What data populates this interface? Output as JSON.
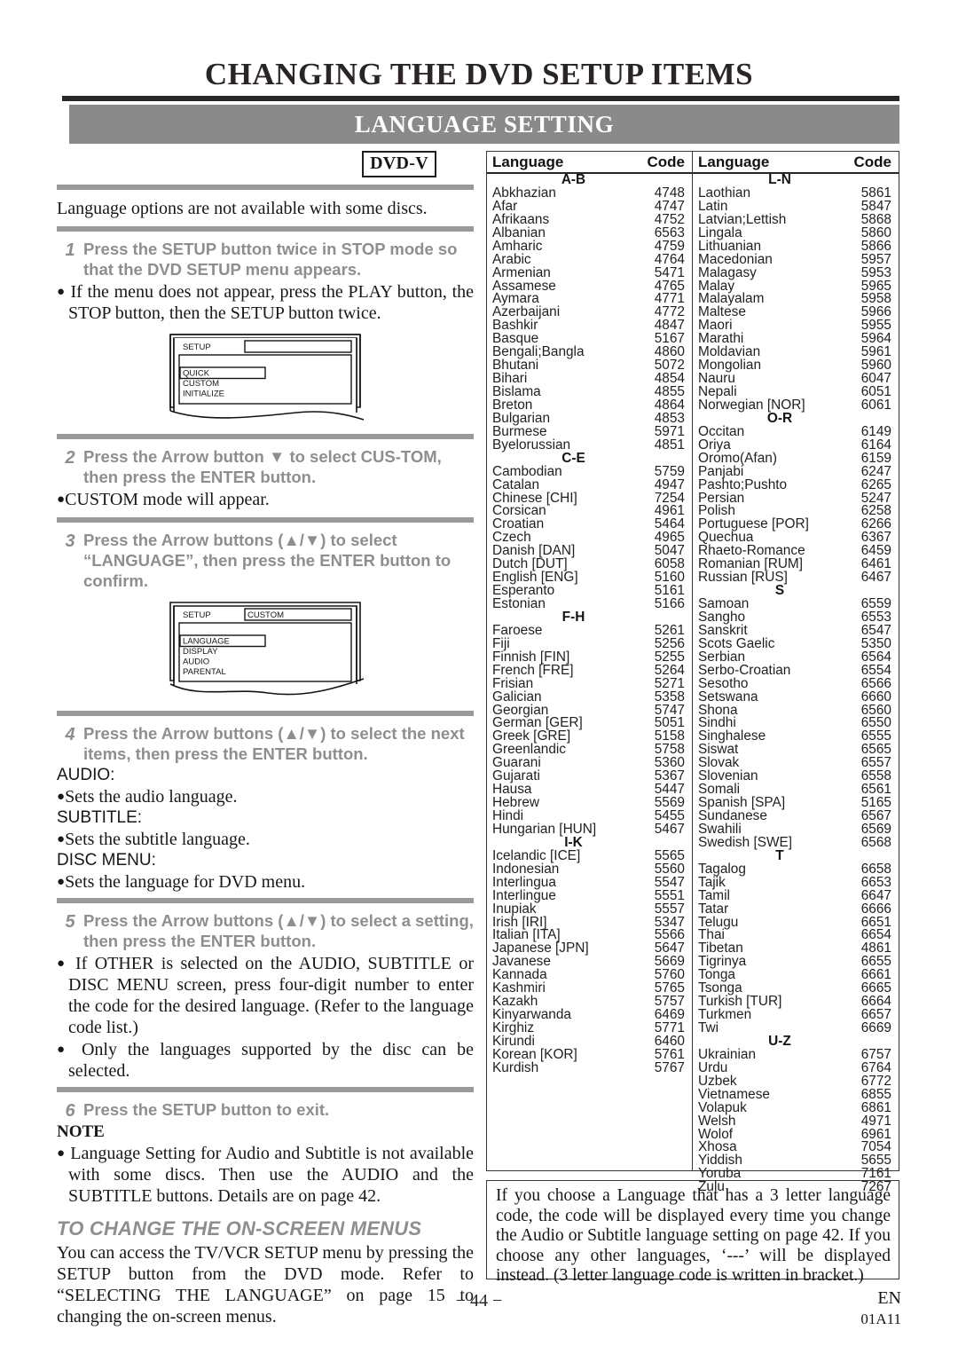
{
  "header": {
    "title": "CHANGING THE DVD SETUP ITEMS",
    "band_title": "LANGUAGE SETTING"
  },
  "left": {
    "badge": "DVD-V",
    "intro": "Language options are not available with some discs.",
    "step1": {
      "num": "1",
      "text": "Press the SETUP button twice in STOP mode so that the DVD SETUP menu appears."
    },
    "step1_bullet": "If the menu does not appear, press the PLAY button, the STOP button, then the SETUP button twice.",
    "osd1": {
      "label": "SETUP",
      "value": "",
      "items": [
        "QUICK",
        "CUSTOM",
        "INITIALIZE"
      ],
      "highlighted": "QUICK"
    },
    "step2": {
      "num": "2",
      "text": "Press the Arrow button ▼ to select CUS-TOM, then press the ENTER button."
    },
    "step2_bullet": "CUSTOM mode will appear.",
    "step3": {
      "num": "3",
      "text": "Press the Arrow buttons (▲/▼) to select “LANGUAGE”, then press the ENTER button to confirm."
    },
    "osd2": {
      "label": "SETUP",
      "value": "CUSTOM",
      "items": [
        "LANGUAGE",
        "DISPLAY",
        "AUDIO",
        "PARENTAL"
      ],
      "highlighted": "LANGUAGE"
    },
    "step4": {
      "num": "4",
      "text": "Press the Arrow buttons (▲/▼) to select the next items, then press the ENTER button."
    },
    "items": [
      {
        "head": "AUDIO:",
        "desc": "Sets the audio language."
      },
      {
        "head": "SUBTITLE:",
        "desc": "Sets the subtitle language."
      },
      {
        "head": "DISC MENU:",
        "desc": "Sets the language for DVD menu."
      }
    ],
    "step5": {
      "num": "5",
      "text": "Press the Arrow buttons (▲/▼) to select a setting, then press the ENTER button."
    },
    "step5_bullet1": "If OTHER is selected on the AUDIO, SUBTITLE or DISC MENU screen, press four-digit number to enter the code for the desired language. (Refer to the language code list.)",
    "step5_bullet2": "Only the languages supported by the disc can be selected.",
    "step6": {
      "num": "6",
      "text": "Press the SETUP button to exit."
    },
    "note_head": "NOTE",
    "note_bullet": "Language Setting for Audio and Subtitle is not available with some discs. Then use the AUDIO and the SUBTITLE buttons. Details are on page 42.",
    "onscreen_head": "TO CHANGE THE ON-SCREEN MENUS",
    "onscreen_body": "You can access the TV/VCR SETUP menu by pressing the SETUP button from the DVD mode. Refer to “SELECTING THE LANGUAGE” on page 15 to changing the on-screen menus."
  },
  "table": {
    "columns": [
      "Language",
      "Code"
    ],
    "left_column": [
      {
        "section": "A-B"
      },
      {
        "name": "Abkhazian",
        "code": "4748"
      },
      {
        "name": "Afar",
        "code": "4747"
      },
      {
        "name": "Afrikaans",
        "code": "4752"
      },
      {
        "name": "Albanian",
        "code": "6563"
      },
      {
        "name": "Amharic",
        "code": "4759"
      },
      {
        "name": "Arabic",
        "code": "4764"
      },
      {
        "name": "Armenian",
        "code": "5471"
      },
      {
        "name": "Assamese",
        "code": "4765"
      },
      {
        "name": "Aymara",
        "code": "4771"
      },
      {
        "name": "Azerbaijani",
        "code": "4772"
      },
      {
        "name": "Bashkir",
        "code": "4847"
      },
      {
        "name": "Basque",
        "code": "5167"
      },
      {
        "name": "Bengali;Bangla",
        "code": "4860"
      },
      {
        "name": "Bhutani",
        "code": "5072"
      },
      {
        "name": "Bihari",
        "code": "4854"
      },
      {
        "name": "Bislama",
        "code": "4855"
      },
      {
        "name": "Breton",
        "code": "4864"
      },
      {
        "name": "Bulgarian",
        "code": "4853"
      },
      {
        "name": "Burmese",
        "code": "5971"
      },
      {
        "name": "Byelorussian",
        "code": "4851"
      },
      {
        "section": "C-E"
      },
      {
        "name": "Cambodian",
        "code": "5759"
      },
      {
        "name": "Catalan",
        "code": "4947"
      },
      {
        "name": "Chinese [CHI]",
        "code": "7254"
      },
      {
        "name": "Corsican",
        "code": "4961"
      },
      {
        "name": "Croatian",
        "code": "5464"
      },
      {
        "name": "Czech",
        "code": "4965"
      },
      {
        "name": "Danish [DAN]",
        "code": "5047"
      },
      {
        "name": "Dutch [DUT]",
        "code": "6058"
      },
      {
        "name": "English [ENG]",
        "code": "5160"
      },
      {
        "name": "Esperanto",
        "code": "5161"
      },
      {
        "name": "Estonian",
        "code": "5166"
      },
      {
        "section": "F-H"
      },
      {
        "name": "Faroese",
        "code": "5261"
      },
      {
        "name": "Fiji",
        "code": "5256"
      },
      {
        "name": "Finnish [FIN]",
        "code": "5255"
      },
      {
        "name": "French [FRE]",
        "code": "5264"
      },
      {
        "name": "Frisian",
        "code": "5271"
      },
      {
        "name": "Galician",
        "code": "5358"
      },
      {
        "name": "Georgian",
        "code": "5747"
      },
      {
        "name": "German [GER]",
        "code": "5051"
      },
      {
        "name": "Greek [GRE]",
        "code": "5158"
      },
      {
        "name": "Greenlandic",
        "code": "5758"
      },
      {
        "name": "Guarani",
        "code": "5360"
      },
      {
        "name": "Gujarati",
        "code": "5367"
      },
      {
        "name": "Hausa",
        "code": "5447"
      },
      {
        "name": "Hebrew",
        "code": "5569"
      },
      {
        "name": "Hindi",
        "code": "5455"
      },
      {
        "name": "Hungarian [HUN]",
        "code": "5467"
      },
      {
        "section": "I-K"
      },
      {
        "name": "Icelandic [ICE]",
        "code": "5565"
      },
      {
        "name": "Indonesian",
        "code": "5560"
      },
      {
        "name": "Interlingua",
        "code": "5547"
      },
      {
        "name": "Interlingue",
        "code": "5551"
      },
      {
        "name": "Inupiak",
        "code": "5557"
      },
      {
        "name": "Irish [IRI]",
        "code": "5347"
      },
      {
        "name": "Italian [ITA]",
        "code": "5566"
      },
      {
        "name": "Japanese [JPN]",
        "code": "5647"
      },
      {
        "name": "Javanese",
        "code": "5669"
      },
      {
        "name": "Kannada",
        "code": "5760"
      },
      {
        "name": "Kashmiri",
        "code": "5765"
      },
      {
        "name": "Kazakh",
        "code": "5757"
      },
      {
        "name": "Kinyarwanda",
        "code": "6469"
      },
      {
        "name": "Kirghiz",
        "code": "5771"
      },
      {
        "name": "Kirundi",
        "code": "6460"
      },
      {
        "name": "Korean [KOR]",
        "code": "5761"
      },
      {
        "name": "Kurdish",
        "code": "5767"
      }
    ],
    "right_column": [
      {
        "section": "L-N"
      },
      {
        "name": "Laothian",
        "code": "5861"
      },
      {
        "name": "Latin",
        "code": "5847"
      },
      {
        "name": "Latvian;Lettish",
        "code": "5868"
      },
      {
        "name": "Lingala",
        "code": "5860"
      },
      {
        "name": "Lithuanian",
        "code": "5866"
      },
      {
        "name": "Macedonian",
        "code": "5957"
      },
      {
        "name": "Malagasy",
        "code": "5953"
      },
      {
        "name": "Malay",
        "code": "5965"
      },
      {
        "name": "Malayalam",
        "code": "5958"
      },
      {
        "name": "Maltese",
        "code": "5966"
      },
      {
        "name": "Maori",
        "code": "5955"
      },
      {
        "name": "Marathi",
        "code": "5964"
      },
      {
        "name": "Moldavian",
        "code": "5961"
      },
      {
        "name": "Mongolian",
        "code": "5960"
      },
      {
        "name": "Nauru",
        "code": "6047"
      },
      {
        "name": "Nepali",
        "code": "6051"
      },
      {
        "name": "Norwegian [NOR]",
        "code": "6061"
      },
      {
        "section": "O-R"
      },
      {
        "name": "Occitan",
        "code": "6149"
      },
      {
        "name": "Oriya",
        "code": "6164"
      },
      {
        "name": "Oromo(Afan)",
        "code": "6159"
      },
      {
        "name": "Panjabi",
        "code": "6247"
      },
      {
        "name": "Pashto;Pushto",
        "code": "6265"
      },
      {
        "name": "Persian",
        "code": "5247"
      },
      {
        "name": "Polish",
        "code": "6258"
      },
      {
        "name": "Portuguese [POR]",
        "code": "6266"
      },
      {
        "name": "Quechua",
        "code": "6367"
      },
      {
        "name": "Rhaeto-Romance",
        "code": "6459"
      },
      {
        "name": "Romanian [RUM]",
        "code": "6461"
      },
      {
        "name": "Russian [RUS]",
        "code": "6467"
      },
      {
        "section": "S"
      },
      {
        "name": "Samoan",
        "code": "6559"
      },
      {
        "name": "Sangho",
        "code": "6553"
      },
      {
        "name": "Sanskrit",
        "code": "6547"
      },
      {
        "name": "Scots Gaelic",
        "code": "5350"
      },
      {
        "name": "Serbian",
        "code": "6564"
      },
      {
        "name": "Serbo-Croatian",
        "code": "6554"
      },
      {
        "name": "Sesotho",
        "code": "6566"
      },
      {
        "name": "Setswana",
        "code": "6660"
      },
      {
        "name": "Shona",
        "code": "6560"
      },
      {
        "name": "Sindhi",
        "code": "6550"
      },
      {
        "name": "Singhalese",
        "code": "6555"
      },
      {
        "name": "Siswat",
        "code": "6565"
      },
      {
        "name": "Slovak",
        "code": "6557"
      },
      {
        "name": "Slovenian",
        "code": "6558"
      },
      {
        "name": "Somali",
        "code": "6561"
      },
      {
        "name": "Spanish [SPA]",
        "code": "5165"
      },
      {
        "name": "Sundanese",
        "code": "6567"
      },
      {
        "name": "Swahili",
        "code": "6569"
      },
      {
        "name": "Swedish [SWE]",
        "code": "6568"
      },
      {
        "section": "T"
      },
      {
        "name": "Tagalog",
        "code": "6658"
      },
      {
        "name": "Tajik",
        "code": "6653"
      },
      {
        "name": "Tamil",
        "code": "6647"
      },
      {
        "name": "Tatar",
        "code": "6666"
      },
      {
        "name": "Telugu",
        "code": "6651"
      },
      {
        "name": "Thai",
        "code": "6654"
      },
      {
        "name": "Tibetan",
        "code": "4861"
      },
      {
        "name": "Tigrinya",
        "code": "6655"
      },
      {
        "name": "Tonga",
        "code": "6661"
      },
      {
        "name": "Tsonga",
        "code": "6665"
      },
      {
        "name": "Turkish [TUR]",
        "code": "6664"
      },
      {
        "name": "Turkmen",
        "code": "6657"
      },
      {
        "name": "Twi",
        "code": "6669"
      },
      {
        "section": "U-Z"
      },
      {
        "name": "Ukrainian",
        "code": "6757"
      },
      {
        "name": "Urdu",
        "code": "6764"
      },
      {
        "name": "Uzbek",
        "code": "6772"
      },
      {
        "name": "Vietnamese",
        "code": "6855"
      },
      {
        "name": "Volapuk",
        "code": "6861"
      },
      {
        "name": "Welsh",
        "code": "4971"
      },
      {
        "name": "Wolof",
        "code": "6961"
      },
      {
        "name": "Xhosa",
        "code": "7054"
      },
      {
        "name": "Yiddish",
        "code": "5655"
      },
      {
        "name": "Yoruba",
        "code": "7161"
      },
      {
        "name": "Zulu",
        "code": "7267"
      }
    ]
  },
  "note_box": "If you choose a Language that has a 3 letter language code, the code will be displayed every time you change the Audio or Subtitle language setting on page 42. If you choose any other languages, ‘---’ will be displayed instead. (3 letter language code is written in bracket.)",
  "footer": {
    "page_number": "− 44 −",
    "lang": "EN",
    "doc_code": "01A11"
  }
}
